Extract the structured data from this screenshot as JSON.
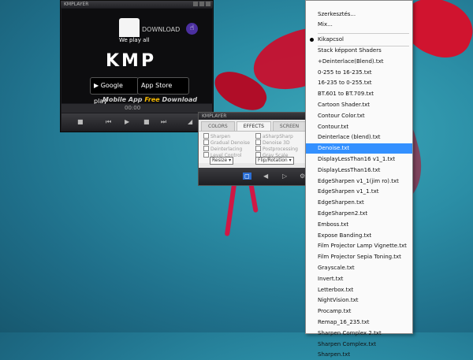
{
  "player": {
    "title": "KMPLAYER",
    "banner_we_play": "We play all",
    "banner_download": "DOWNLOAD",
    "logo_text": "KMP",
    "google_play": "Google play",
    "app_store": "App Store",
    "tagline_prefix": "Mobile App ",
    "tagline_free": "Free",
    "tagline_suffix": " Download",
    "time": "00:00"
  },
  "effects": {
    "title": "KMPLAYER",
    "tabs": [
      "COLORS",
      "EFFECTS",
      "SCREEN"
    ],
    "left_options": [
      "Sharpen",
      "Gradual Denoise",
      "Deinterlacing",
      "Level Control"
    ],
    "right_options": [
      "aSharpSharp",
      "Denoise 3D",
      "Postprocessing",
      "Gray Scale"
    ],
    "resize_label": "Resize",
    "flip_label": "Flip/Rotation"
  },
  "menu": {
    "top_items": [
      "Szerkesztés...",
      "Mix..."
    ],
    "checked_item": "Kikapcsol",
    "items": [
      "Stack képpont Shaders",
      "+Deinterlace(Blend).txt",
      "0-255 to 16-235.txt",
      "16-235 to 0-255.txt",
      "BT.601 to BT.709.txt",
      "Cartoon Shader.txt",
      "Contour Color.txt",
      "Contour.txt",
      "Deinterlace (blend).txt",
      "Denoise.txt",
      "DisplayLessThan16 v1_1.txt",
      "DisplayLessThan16.txt",
      "EdgeSharpen v1_1(jim ro).txt",
      "EdgeSharpen v1_1.txt",
      "EdgeSharpen.txt",
      "EdgeSharpen2.txt",
      "Emboss.txt",
      "Expose Banding.txt",
      "Film Projector Lamp Vignette.txt",
      "Film Projector Sepia Toning.txt",
      "Grayscale.txt",
      "Invert.txt",
      "Letterbox.txt",
      "NightVision.txt",
      "Procamp.txt",
      "Remap_16_235.txt",
      "Sharpen Complex 2.txt",
      "Sharpen Complex.txt",
      "Sharpen.txt"
    ],
    "highlighted_item": "Denoise.txt",
    "highlight_color": "#3390ff"
  }
}
